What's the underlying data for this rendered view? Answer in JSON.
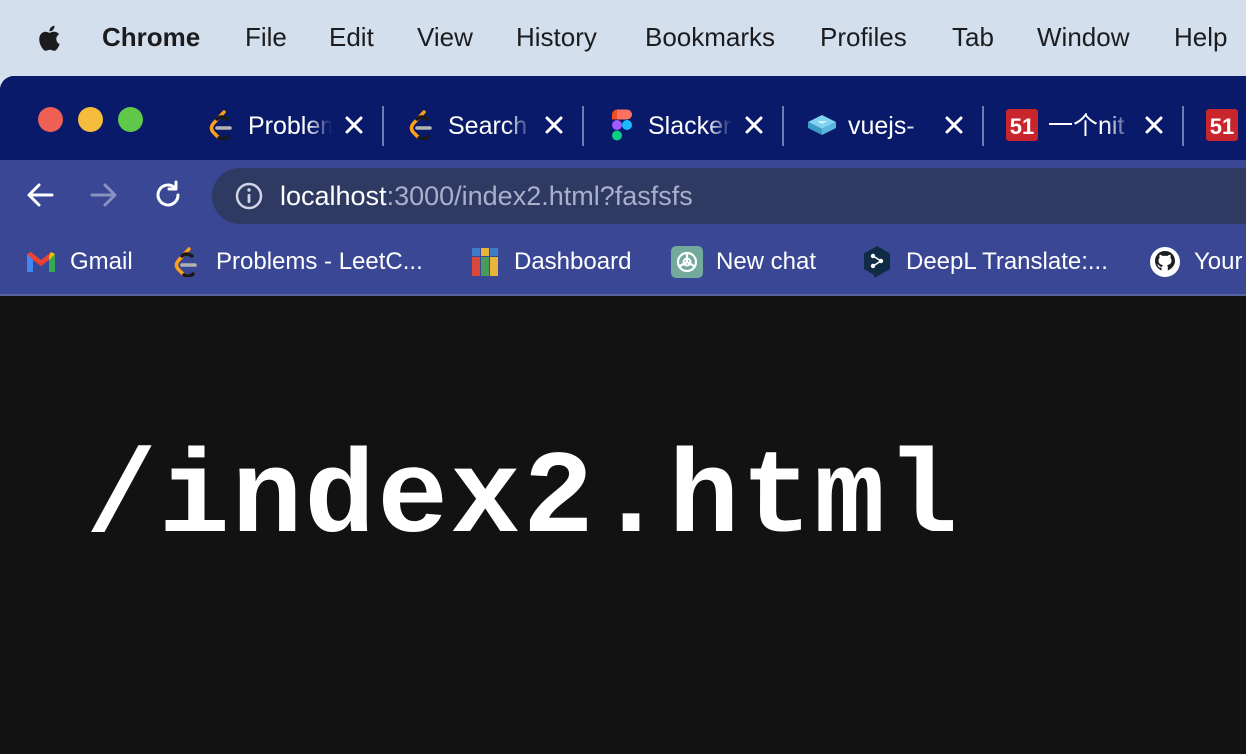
{
  "menubar": {
    "app_name": "Chrome",
    "items": [
      "File",
      "Edit",
      "View",
      "History",
      "Bookmarks",
      "Profiles",
      "Tab",
      "Window",
      "Help"
    ]
  },
  "tabs": [
    {
      "title": "Problems",
      "icon": "leetcode-icon"
    },
    {
      "title": "Search",
      "icon": "leetcode-icon"
    },
    {
      "title": "Slacker",
      "icon": "figma-icon"
    },
    {
      "title": "vuejs-",
      "icon": "cube-icon"
    },
    {
      "title": "一个nit",
      "icon": "51-icon"
    },
    {
      "title": "",
      "icon": "51-icon"
    }
  ],
  "toolbar": {
    "url_host": "localhost",
    "url_rest": ":3000/index2.html?fasfsfs"
  },
  "bookmarks": [
    {
      "label": "Gmail",
      "icon": "gmail-icon"
    },
    {
      "label": "Problems - LeetC...",
      "icon": "leetcode-icon"
    },
    {
      "label": "Dashboard",
      "icon": "dashboard-icon"
    },
    {
      "label": "New chat",
      "icon": "chatgpt-icon"
    },
    {
      "label": "DeepL Translate:...",
      "icon": "deepl-icon"
    },
    {
      "label": "Your",
      "icon": "github-icon"
    }
  ],
  "page": {
    "heading": "/index2.html"
  },
  "colors": {
    "tabstrip": "#0a1a6a",
    "toolbar": "#3a4794",
    "page_background": "#121212",
    "menubar": "#d4dfee"
  }
}
